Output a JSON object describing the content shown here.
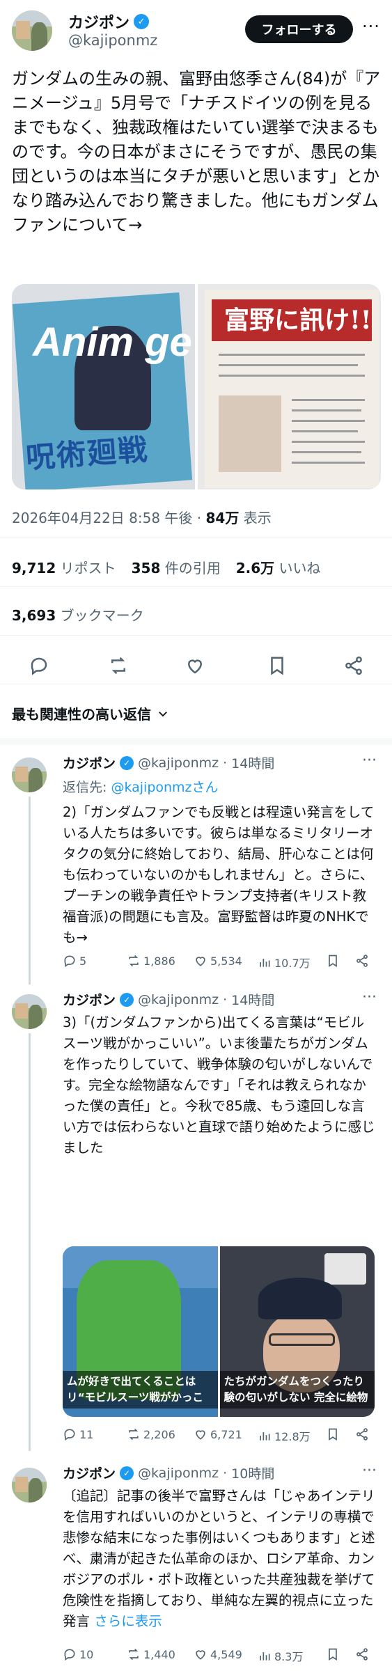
{
  "main_tweet": {
    "author_name": "カジポン",
    "handle": "@kajiponmz",
    "follow_label": "フォローする",
    "text": "ガンダムの生みの親、富野由悠季さん(84)が『アニメージュ』5月号で「ナチスドイツの例を見るまでもなく、独裁政権はたいてい選挙で決まるものです。今の日本がまさにそうですが、愚民の集団というのは本当にタチが悪いと思います」とかなり踏み込んでおり驚きました。他にもガンダムファンについて→",
    "images": [
      {
        "logo_text": "Anim ge",
        "caption_text": "呪術廻戦"
      },
      {
        "banner_text": "富野に訊け!!"
      }
    ],
    "timestamp": "2026年04月22日 8:58 午後",
    "views": "84万",
    "views_label": "表示",
    "reposts": "9,712",
    "reposts_label": "リポスト",
    "quotes": "358",
    "quotes_label": "件の引用",
    "likes": "2.6万",
    "likes_label": "いいね",
    "bookmarks": "3,693",
    "bookmarks_label": "ブックマーク"
  },
  "sort_label": "最も関連性の高い返信",
  "replies": [
    {
      "author_name": "カジポン",
      "handle": "@kajiponmz",
      "time": "14時間",
      "reply_to_prefix": "返信先:",
      "reply_to_handle": "@kajiponmzさん",
      "text": "2)「ガンダムファンでも反戦とは程遠い発言をしている人たちは多いです。彼らは単なるミリタリーオタクの気分に終始しており、結局、肝心なことは何も伝わっていないのかもしれません」と。さらに、プーチンの戦争責任やトランプ支持者(キリスト教福音派)の問題にも言及。富野監督は昨夏のNHKでも→",
      "replies": "5",
      "reposts": "1,886",
      "likes": "5,534",
      "views": "10.7万"
    },
    {
      "author_name": "カジポン",
      "handle": "@kajiponmz",
      "time": "14時間",
      "text": "3)「(ガンダムファンから)出てくる言葉は“モビルスーツ戦がかっこいい”。いま後輩たちがガンダムを作ったりしていて、戦争体験の匂いがしないんです。完全な絵物語なんです」「それは教えられなかった僕の責任」と。今秋で85歳、もう遠回しな言い方では伝わらないと直球で語り始めたように感じました",
      "image_left_subtitle": "ムが好きで出てくることは\nリ“モビルスーツ戦がかっこ",
      "image_right_subtitle": "たちがガンダムをつくったり\n験の匂いがしない 完全に絵物",
      "replies": "11",
      "reposts": "2,206",
      "likes": "6,721",
      "views": "12.8万"
    },
    {
      "author_name": "カジポン",
      "handle": "@kajiponmz",
      "time": "10時間",
      "text": "〔追記〕記事の後半で富野さんは「じゃあインテリを信用すればいいのかというと、インテリの専横で悲惨な結末になった事例はいくつもあります」と述べ、粛清が起きた仏革命のほか、ロシア革命、カンボジアのポル・ポト政権といった共産独裁を挙げて危険性を指摘しており、単純な左翼的視点に立った発言",
      "show_more": "さらに表示",
      "replies": "10",
      "reposts": "1,440",
      "likes": "4,549",
      "views": "8.3万"
    }
  ]
}
